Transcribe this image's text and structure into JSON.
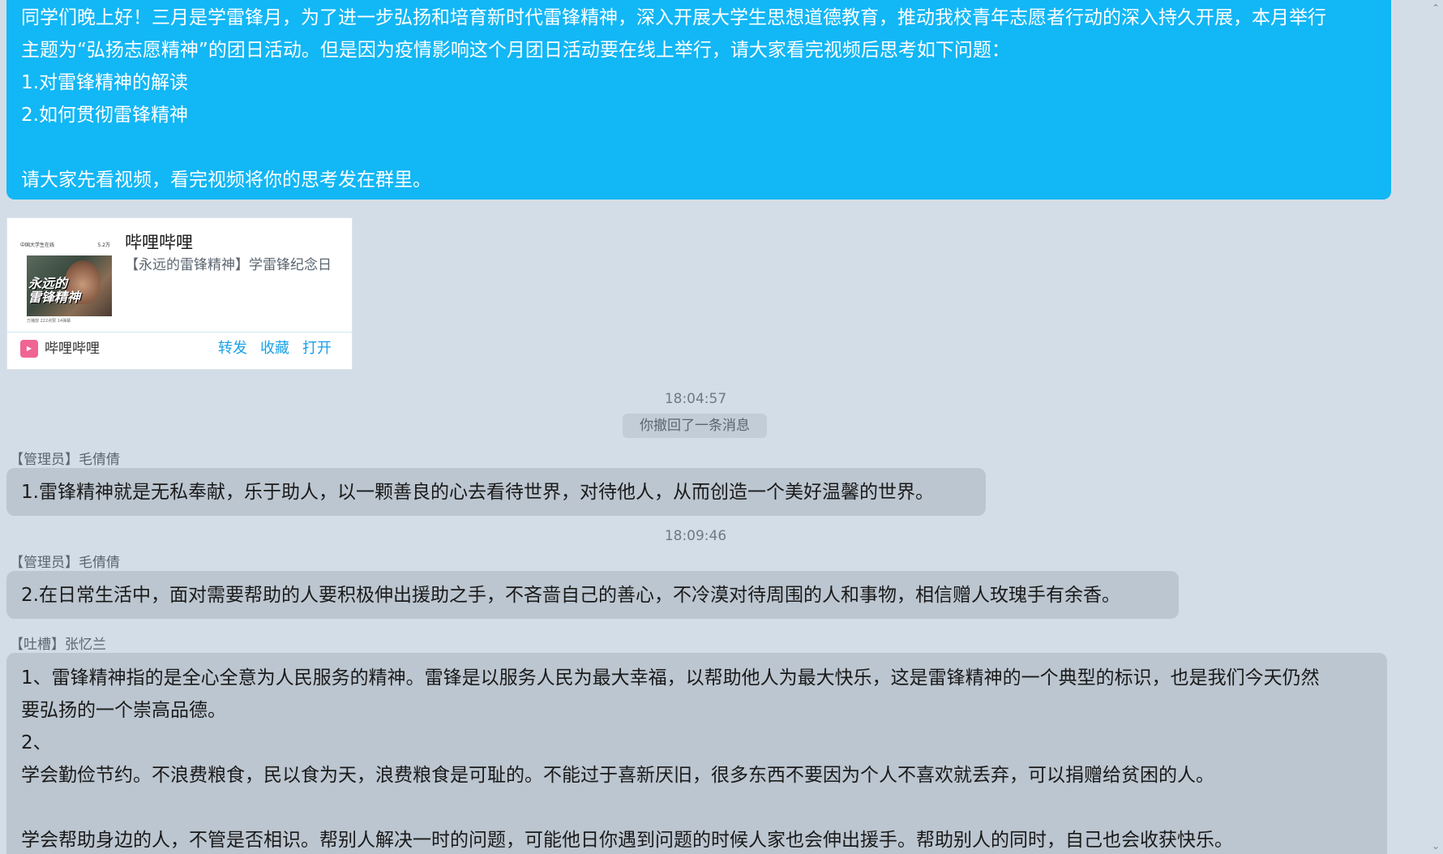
{
  "messages": {
    "announcement": {
      "text": "同学们晚上好！三月是学雷锋月，为了进一步弘扬和培育新时代雷锋精神，深入开展大学生思想道德教育，推动我校青年志愿者行动的深入持久开展，本月举行\n主题为“弘扬志愿精神”的团日活动。但是因为疫情影响这个月团日活动要在线上举行，请大家看完视频后思考如下问题：\n1.对雷锋精神的解读\n2.如何贯彻雷锋精神\n\n请大家先看视频，看完视频将你的思考发在群里。"
    },
    "share_card": {
      "title": "哔哩哔哩",
      "description": "【永远的雷锋精神】学雷锋纪念日",
      "app_name": "哔哩哔哩",
      "app_icon": "bilibili-icon",
      "actions": {
        "forward": "转发",
        "favorite": "收藏",
        "open": "打开"
      },
      "thumbnail": {
        "header_left": "中国大学生在线",
        "header_right": "5.2万",
        "overlay_text": "永远的\n雷锋精神",
        "footer": "万播放 222点赞 14弹幕"
      }
    },
    "time_1": "18:04:57",
    "recall_notice": "你撤回了一条消息",
    "msg_1": {
      "sender": "【管理员】毛倩倩",
      "text": "1.雷锋精神就是无私奉献，乐于助人，以一颗善良的心去看待世界，对待他人，从而创造一个美好温馨的世界。"
    },
    "time_2": "18:09:46",
    "msg_2": {
      "sender": "【管理员】毛倩倩",
      "text": "2.在日常生活中，面对需要帮助的人要积极伸出援助之手，不吝啬自己的善心，不冷漠对待周围的人和事物，相信赠人玫瑰手有余香。"
    },
    "msg_3": {
      "sender": "【吐槽】张忆兰",
      "text": "1、雷锋精神指的是全心全意为人民服务的精神。雷锋是以服务人民为最大幸福，以帮助他人为最大快乐，这是雷锋精神的一个典型的标识，也是我们今天仍然\n要弘扬的一个崇高品德。\n2、\n学会勤俭节约。不浪费粮食，民以食为天，浪费粮食是可耻的。不能过于喜新厌旧，很多东西不要因为个人不喜欢就丢弃，可以捐赠给贫困的人。\n\n学会帮助身边的人，不管是否相识。帮别人解决一时的问题，可能他日你遇到问题的时候人家也会伸出援手。帮助别人的同时，自己也会收获快乐。"
    }
  },
  "colors": {
    "self_bubble": "#12b7f5",
    "other_bubble": "#bcc6d0",
    "background": "#d3dde8",
    "link": "#1aa1e6"
  }
}
